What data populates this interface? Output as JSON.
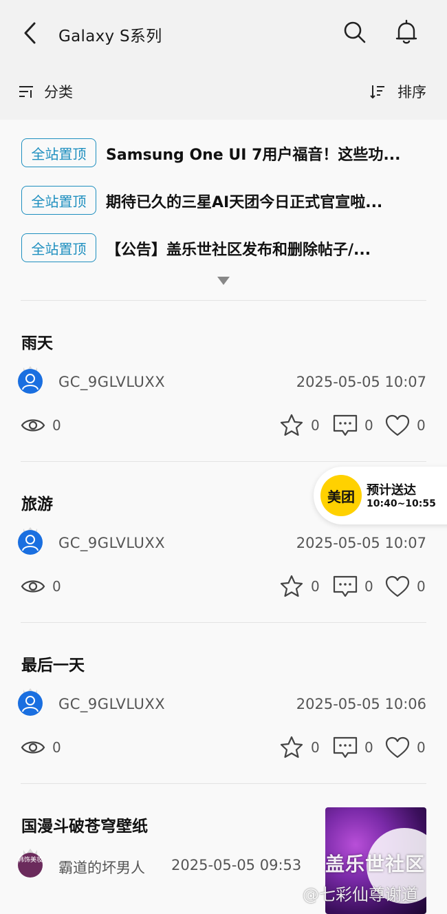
{
  "header": {
    "title": "Galaxy S系列"
  },
  "filters": {
    "category_label": "分类",
    "sort_label": "排序"
  },
  "pinned": [
    {
      "badge": "全站置顶",
      "title": "Samsung One UI 7用户福音！这些功..."
    },
    {
      "badge": "全站置顶",
      "title": "期待已久的三星AI天团今日正式官宣啦..."
    },
    {
      "badge": "全站置顶",
      "title": "【公告】盖乐世社区发布和删除帖子/..."
    }
  ],
  "posts": [
    {
      "title": "雨天",
      "user": "GC_9GLVLUXX",
      "time": "2025-05-05 10:07",
      "views": "0",
      "favorites": "0",
      "comments": "0",
      "likes": "0"
    },
    {
      "title": "旅游",
      "user": "GC_9GLVLUXX",
      "time": "2025-05-05 10:07",
      "views": "0",
      "favorites": "0",
      "comments": "0",
      "likes": "0"
    },
    {
      "title": "最后一天",
      "user": "GC_9GLVLUXX",
      "time": "2025-05-05 10:06",
      "views": "0",
      "favorites": "0",
      "comments": "0",
      "likes": "0"
    },
    {
      "title": "国漫斗破苍穹壁纸",
      "user": "霸道的坏男人",
      "time": "2025-05-05 09:53",
      "avatar_text": "韩饰美妆"
    }
  ],
  "meituan": {
    "logo": "美团",
    "line1": "预计送达",
    "line2": "10:40~10:55"
  },
  "watermark": {
    "line1": "盖乐世社区",
    "line2": "@七彩仙尊谢道"
  },
  "colors": {
    "accent": "#1e8fbf",
    "avatar_blue": "#1a6fe0",
    "meituan_yellow": "#ffd100"
  }
}
